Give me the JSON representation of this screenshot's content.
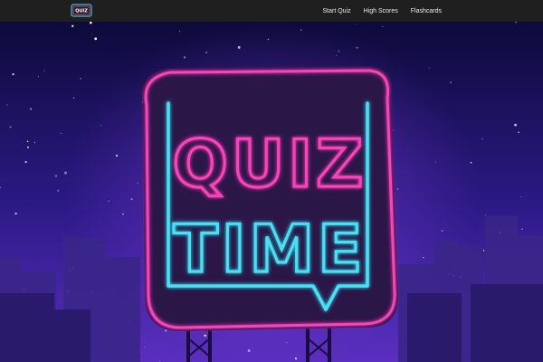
{
  "app": {
    "logo_icon": "quiz-logo-icon",
    "nav": [
      {
        "label": "Start Quiz"
      },
      {
        "label": "High Scores"
      },
      {
        "label": "Flashcards"
      }
    ]
  },
  "hero": {
    "sign_line1": "QUIZ",
    "sign_line2": "TIME",
    "colors": {
      "pink_neon": "#ff3fb8",
      "cyan_neon": "#3fe4f5",
      "sky_top": "#0d0a3a",
      "sky_bottom": "#5a2fc0"
    }
  }
}
